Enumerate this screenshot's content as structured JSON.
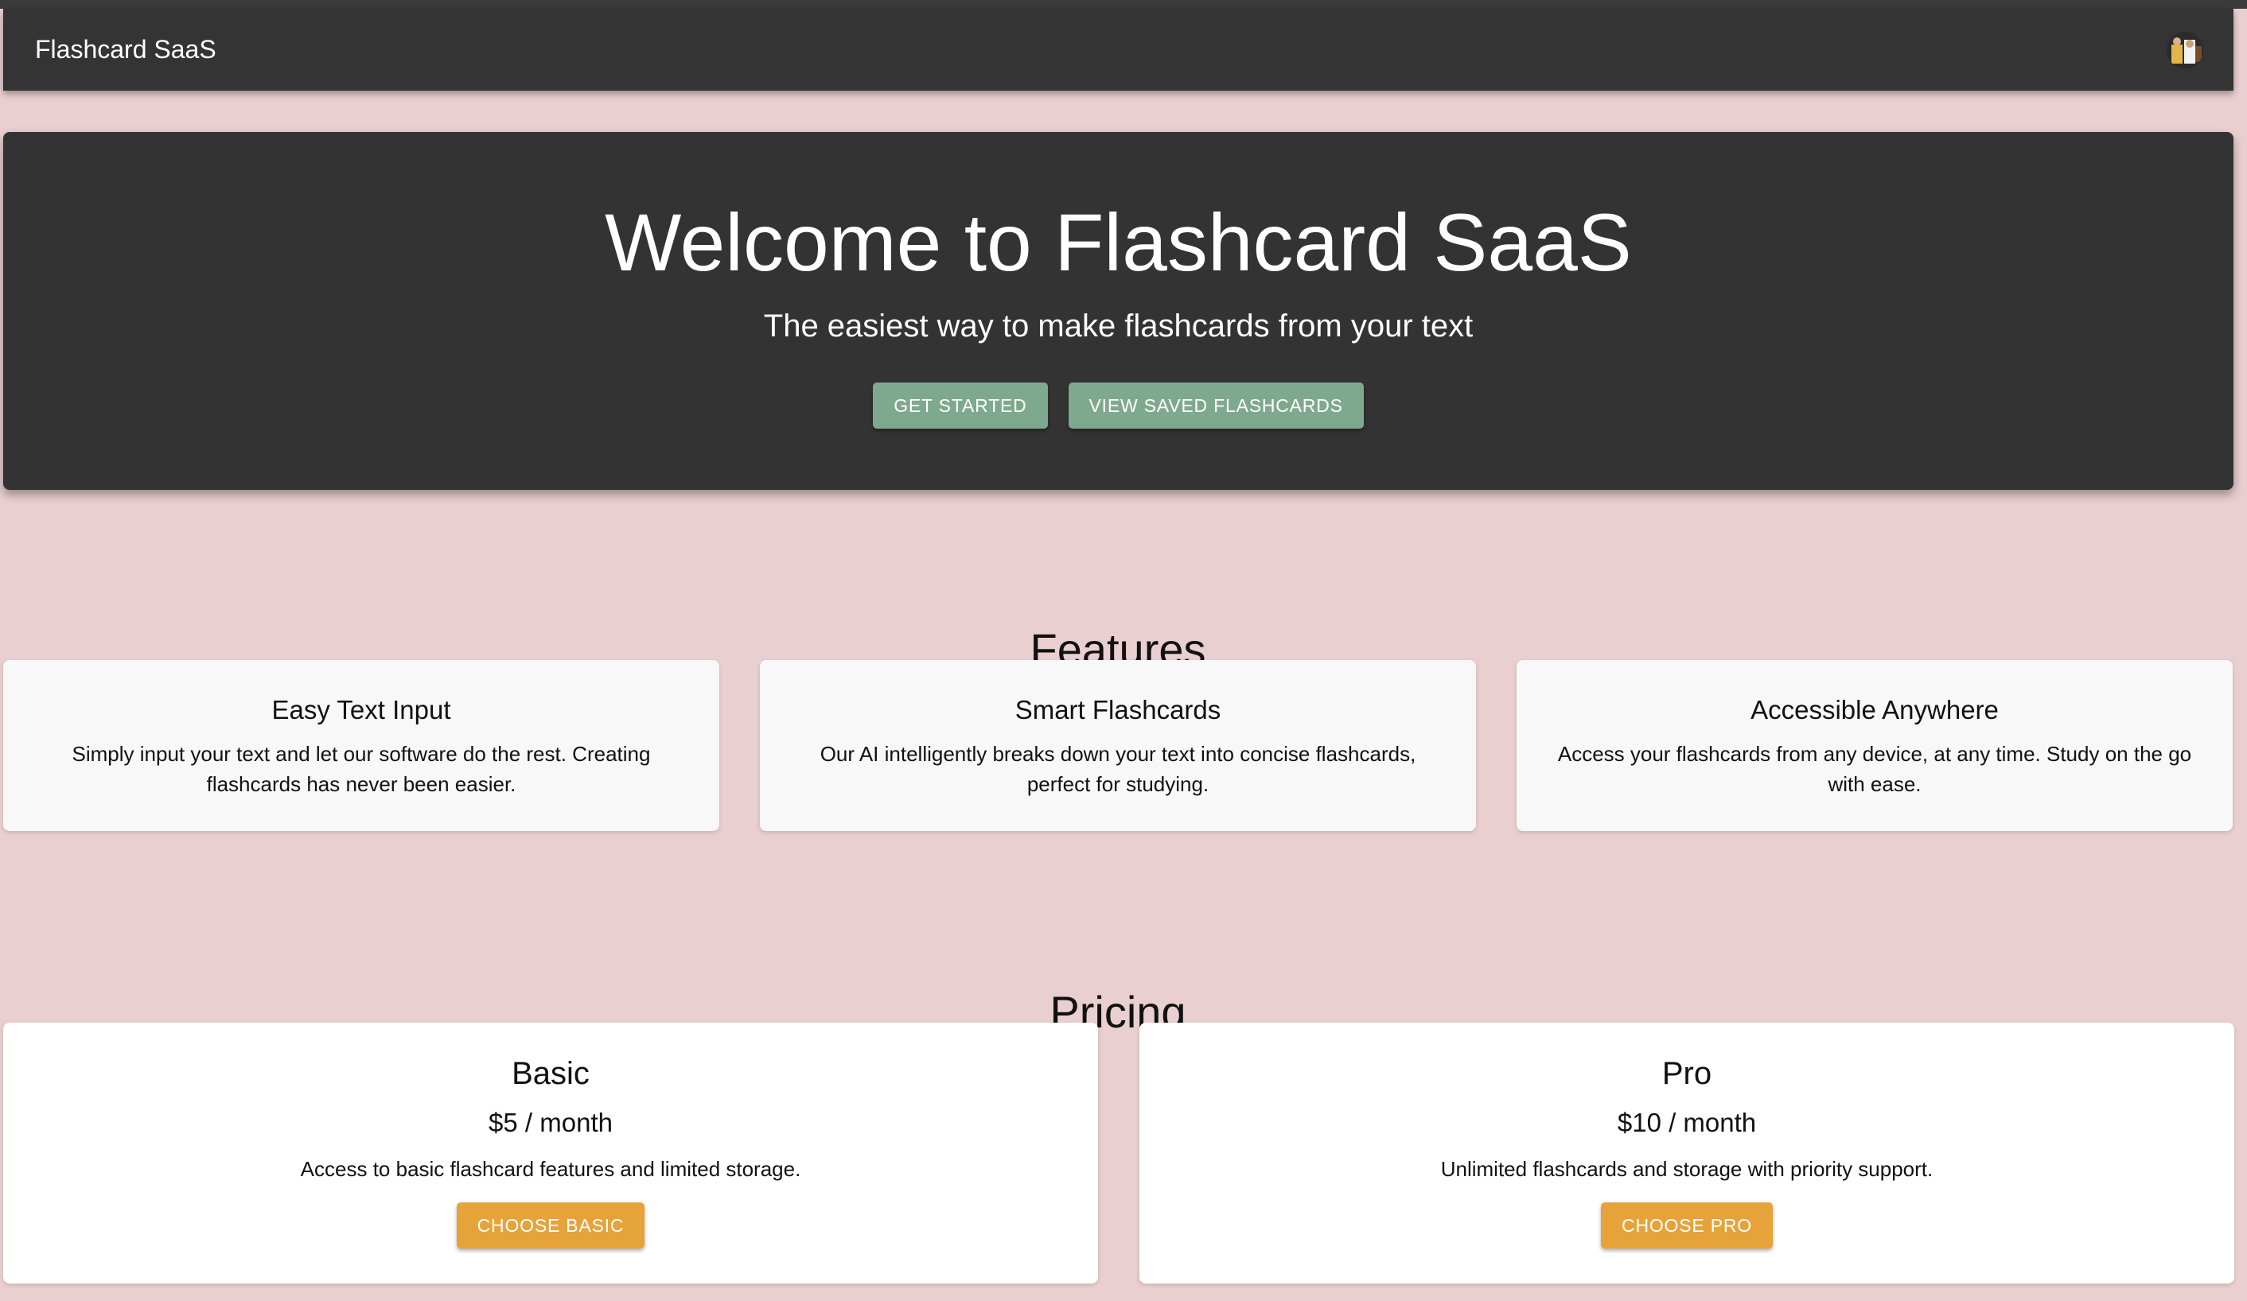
{
  "appbar": {
    "title": "Flashcard SaaS",
    "avatar_icon": "user-avatar"
  },
  "hero": {
    "title": "Welcome to Flashcard SaaS",
    "subtitle": "The easiest way to make flashcards from your text",
    "buttons": {
      "get_started": "Get Started",
      "view_saved": "View Saved Flashcards"
    }
  },
  "features": {
    "title": "Features",
    "items": [
      {
        "title": "Easy Text Input",
        "description": "Simply input your text and let our software do the rest. Creating flashcards has never been easier."
      },
      {
        "title": "Smart Flashcards",
        "description": "Our AI intelligently breaks down your text into concise flashcards, perfect for studying."
      },
      {
        "title": "Accessible Anywhere",
        "description": "Access your flashcards from any device, at any time. Study on the go with ease."
      }
    ]
  },
  "pricing": {
    "title": "Pricing",
    "plans": [
      {
        "name": "Basic",
        "price": "$5 / month",
        "description": "Access to basic flashcard features and limited storage.",
        "button": "Choose Basic"
      },
      {
        "name": "Pro",
        "price": "$10 / month",
        "description": "Unlimited flashcards and storage with priority support.",
        "button": "Choose Pro"
      }
    ]
  },
  "colors": {
    "page_background": "#e9cfd0",
    "appbar": "#343434",
    "hero": "#333333",
    "primary_button": "#7fa98f",
    "pricing_button": "#e6a33a"
  }
}
